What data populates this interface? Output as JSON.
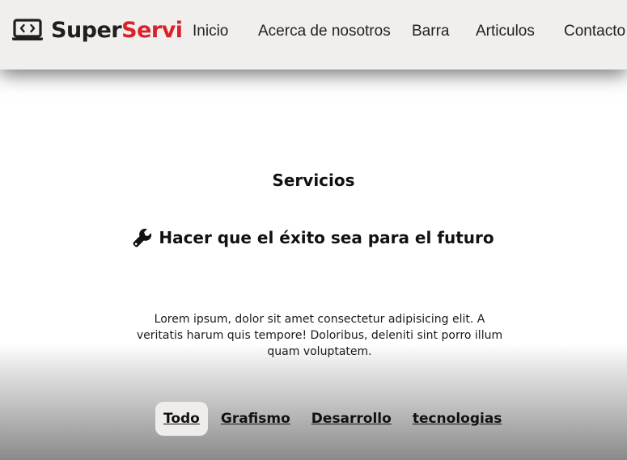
{
  "brand": {
    "name_part1": "Super",
    "name_part2": "Servi",
    "icon": "laptop-code-icon",
    "color_part1": "#1f1f1f",
    "color_part2": "#d8232a"
  },
  "nav": {
    "items": [
      {
        "label": "Inicio"
      },
      {
        "label": "Acerca de nosotros"
      },
      {
        "label": "Barra"
      },
      {
        "label": "Articulos"
      },
      {
        "label": "Contacto"
      }
    ]
  },
  "main": {
    "title": "Servicios",
    "subheading": "Hacer que el éxito sea para el futuro",
    "subheading_icon": "wrench-icon",
    "paragraph": "Lorem ipsum, dolor sit amet consectetur adipisicing elit. A veritatis harum quis tempore! Doloribus, deleniti sint porro illum quam voluptatem."
  },
  "filters": {
    "active": "Todo",
    "tabs": [
      {
        "label": "Todo"
      },
      {
        "label": "Grafismo"
      },
      {
        "label": "Desarrollo"
      },
      {
        "label": "tecnologias"
      }
    ]
  }
}
